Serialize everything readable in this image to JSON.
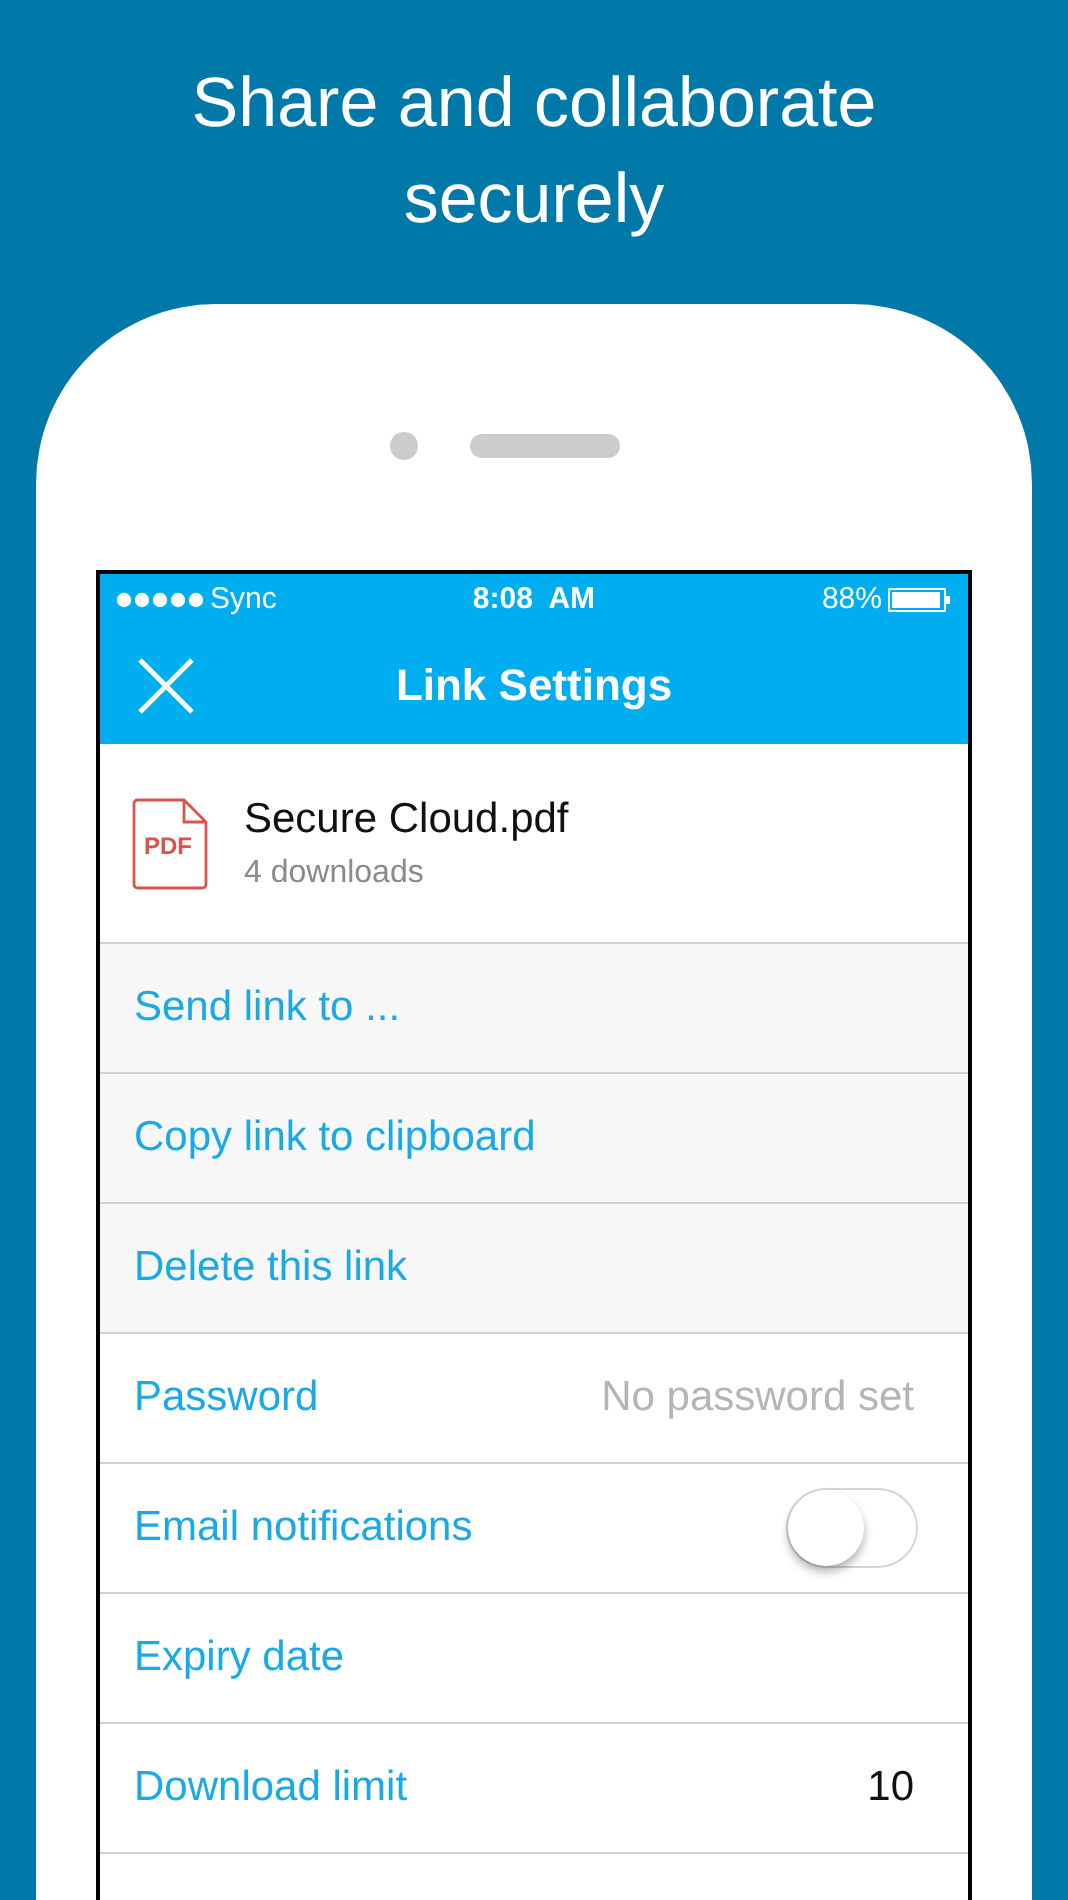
{
  "headline": "Share and collaborate securely",
  "status_bar": {
    "carrier": "Sync",
    "time": "8:08  AM",
    "battery": "88%"
  },
  "nav_bar": {
    "title": "Link Settings"
  },
  "file": {
    "icon_label": "PDF",
    "name": "Secure Cloud.pdf",
    "downloads": "4 downloads"
  },
  "rows": [
    {
      "kind": "action",
      "label": "Send link to ..."
    },
    {
      "kind": "action",
      "label": "Copy link to clipboard"
    },
    {
      "kind": "action",
      "label": "Delete this link"
    },
    {
      "kind": "value",
      "label": "Password",
      "value": "No password set",
      "muted": true
    },
    {
      "kind": "toggle",
      "label": "Email notifications",
      "on": false
    },
    {
      "kind": "value",
      "label": "Expiry date"
    },
    {
      "kind": "value",
      "label": "Download limit",
      "value": "10",
      "muted": false
    }
  ]
}
